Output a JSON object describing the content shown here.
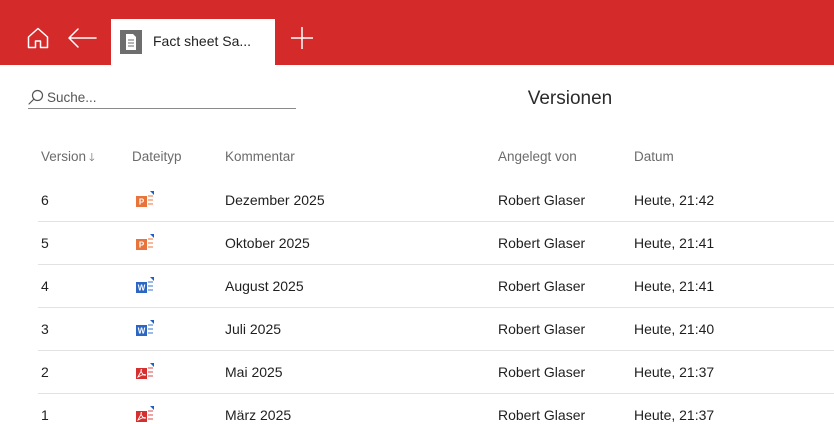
{
  "header": {
    "tab_label": "Fact sheet Sa...",
    "accent_color": "#d42a2a"
  },
  "search": {
    "placeholder": "Suche..."
  },
  "page": {
    "title": "Versionen"
  },
  "table": {
    "columns": {
      "version": "Version",
      "filetype": "Dateityp",
      "comment": "Kommentar",
      "created_by": "Angelegt von",
      "date": "Datum"
    },
    "sort_indicator": "🡓",
    "rows": [
      {
        "version": "6",
        "filetype": "powerpoint-icon",
        "comment": "Dezember 2025",
        "created_by": "Robert Glaser",
        "date": "Heute, 21:42"
      },
      {
        "version": "5",
        "filetype": "powerpoint-icon",
        "comment": "Oktober 2025",
        "created_by": "Robert Glaser",
        "date": "Heute, 21:41"
      },
      {
        "version": "4",
        "filetype": "word-icon",
        "comment": "August 2025",
        "created_by": "Robert Glaser",
        "date": "Heute, 21:41"
      },
      {
        "version": "3",
        "filetype": "word-icon",
        "comment": "Juli 2025",
        "created_by": "Robert Glaser",
        "date": "Heute, 21:40"
      },
      {
        "version": "2",
        "filetype": "pdf-icon",
        "comment": "Mai 2025",
        "created_by": "Robert Glaser",
        "date": "Heute, 21:37"
      },
      {
        "version": "1",
        "filetype": "pdf-icon",
        "comment": "März 2025",
        "created_by": "Robert Glaser",
        "date": "Heute, 21:37"
      }
    ]
  },
  "icon_colors": {
    "powerpoint": "#e8743b",
    "word": "#2b66c4",
    "pdf": "#d62f2f"
  }
}
